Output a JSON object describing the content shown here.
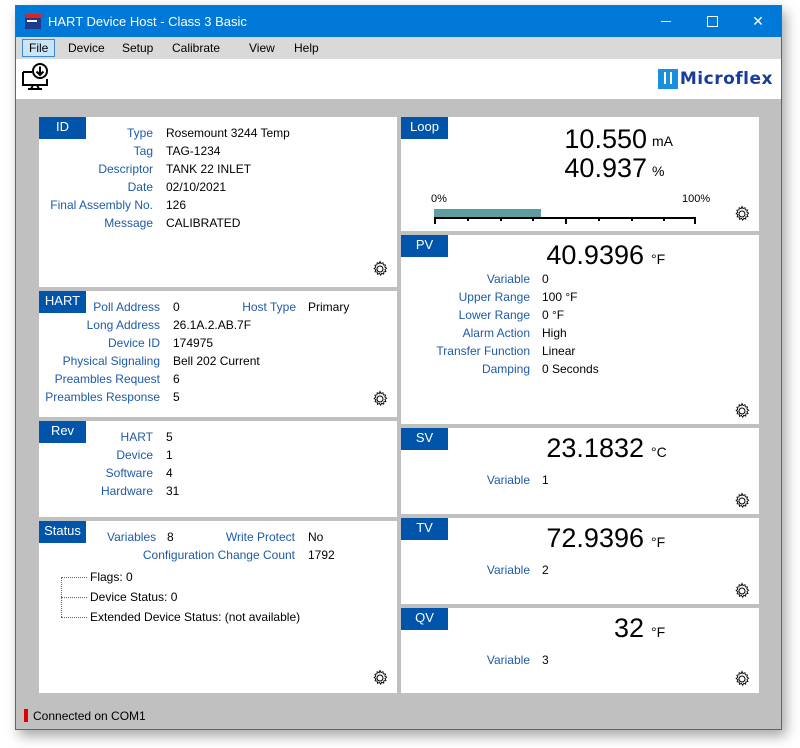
{
  "window": {
    "title": "HART Device Host - Class 3 Basic",
    "controls": {
      "minimize": "minimize",
      "maximize": "maximize",
      "close": "✕"
    }
  },
  "menu": [
    "File",
    "Device",
    "Setup",
    "Calibrate",
    "View",
    "Help"
  ],
  "toolbar": {
    "download_icon": "computer-download-icon",
    "logo_text": "Microflex"
  },
  "id_panel": {
    "tag": "ID",
    "rows": [
      {
        "label": "Type",
        "value": "Rosemount 3244 Temp"
      },
      {
        "label": "Tag",
        "value": "TAG-1234"
      },
      {
        "label": "Descriptor",
        "value": "TANK 22 INLET"
      },
      {
        "label": "Date",
        "value": "02/10/2021"
      },
      {
        "label": "Final Assembly No.",
        "value": "126"
      },
      {
        "label": "Message",
        "value": "CALIBRATED"
      }
    ]
  },
  "hart_panel": {
    "tag": "HART",
    "host_type_label": "Host Type",
    "host_type_value": "Primary",
    "rows": [
      {
        "label": "Poll Address",
        "value": "0"
      },
      {
        "label": "Long Address",
        "value": "26.1A.2.AB.7F"
      },
      {
        "label": "Device ID",
        "value": "174975"
      },
      {
        "label": "Physical Signaling",
        "value": "Bell 202 Current"
      },
      {
        "label": "Preambles Request",
        "value": "6"
      },
      {
        "label": "Preambles Response",
        "value": "5"
      }
    ]
  },
  "rev_panel": {
    "tag": "Rev",
    "rows": [
      {
        "label": "HART",
        "value": "5"
      },
      {
        "label": "Device",
        "value": "1"
      },
      {
        "label": "Software",
        "value": "4"
      },
      {
        "label": "Hardware",
        "value": "31"
      }
    ]
  },
  "status_panel": {
    "tag": "Status",
    "variables_label": "Variables",
    "variables_value": "8",
    "write_protect_label": "Write Protect",
    "write_protect_value": "No",
    "config_change_label": "Configuration Change Count",
    "config_change_value": "1792",
    "tree": [
      "Flags: 0",
      "Device Status: 0",
      "Extended Device Status: (not available)"
    ]
  },
  "loop_panel": {
    "tag": "Loop",
    "current": "10.550",
    "current_unit": "mA",
    "percent": "40.937",
    "percent_unit": "%",
    "bar_min_label": "0%",
    "bar_max_label": "100%",
    "bar_fill_percent": 40.937
  },
  "pv_panel": {
    "tag": "PV",
    "value": "40.9396",
    "unit": "°F",
    "rows": [
      {
        "label": "Variable",
        "value": "0"
      },
      {
        "label": "Upper Range",
        "value": "100 °F"
      },
      {
        "label": "Lower Range",
        "value": "0 °F"
      },
      {
        "label": "Alarm Action",
        "value": "High"
      },
      {
        "label": "Transfer Function",
        "value": "Linear"
      },
      {
        "label": "Damping",
        "value": "0 Seconds"
      }
    ]
  },
  "sv_panel": {
    "tag": "SV",
    "value": "23.1832",
    "unit": "°C",
    "variable_label": "Variable",
    "variable_value": "1"
  },
  "tv_panel": {
    "tag": "TV",
    "value": "72.9396",
    "unit": "°F",
    "variable_label": "Variable",
    "variable_value": "2"
  },
  "qv_panel": {
    "tag": "QV",
    "value": "32",
    "unit": "°F",
    "variable_label": "Variable",
    "variable_value": "3"
  },
  "statusbar": {
    "text": "Connected on COM1",
    "indicator_color": "#e00000"
  },
  "colors": {
    "accent": "#0055aa",
    "label": "#1e5aa8",
    "titlebar": "#0078d7",
    "bar_fill": "#5f9ea0"
  }
}
